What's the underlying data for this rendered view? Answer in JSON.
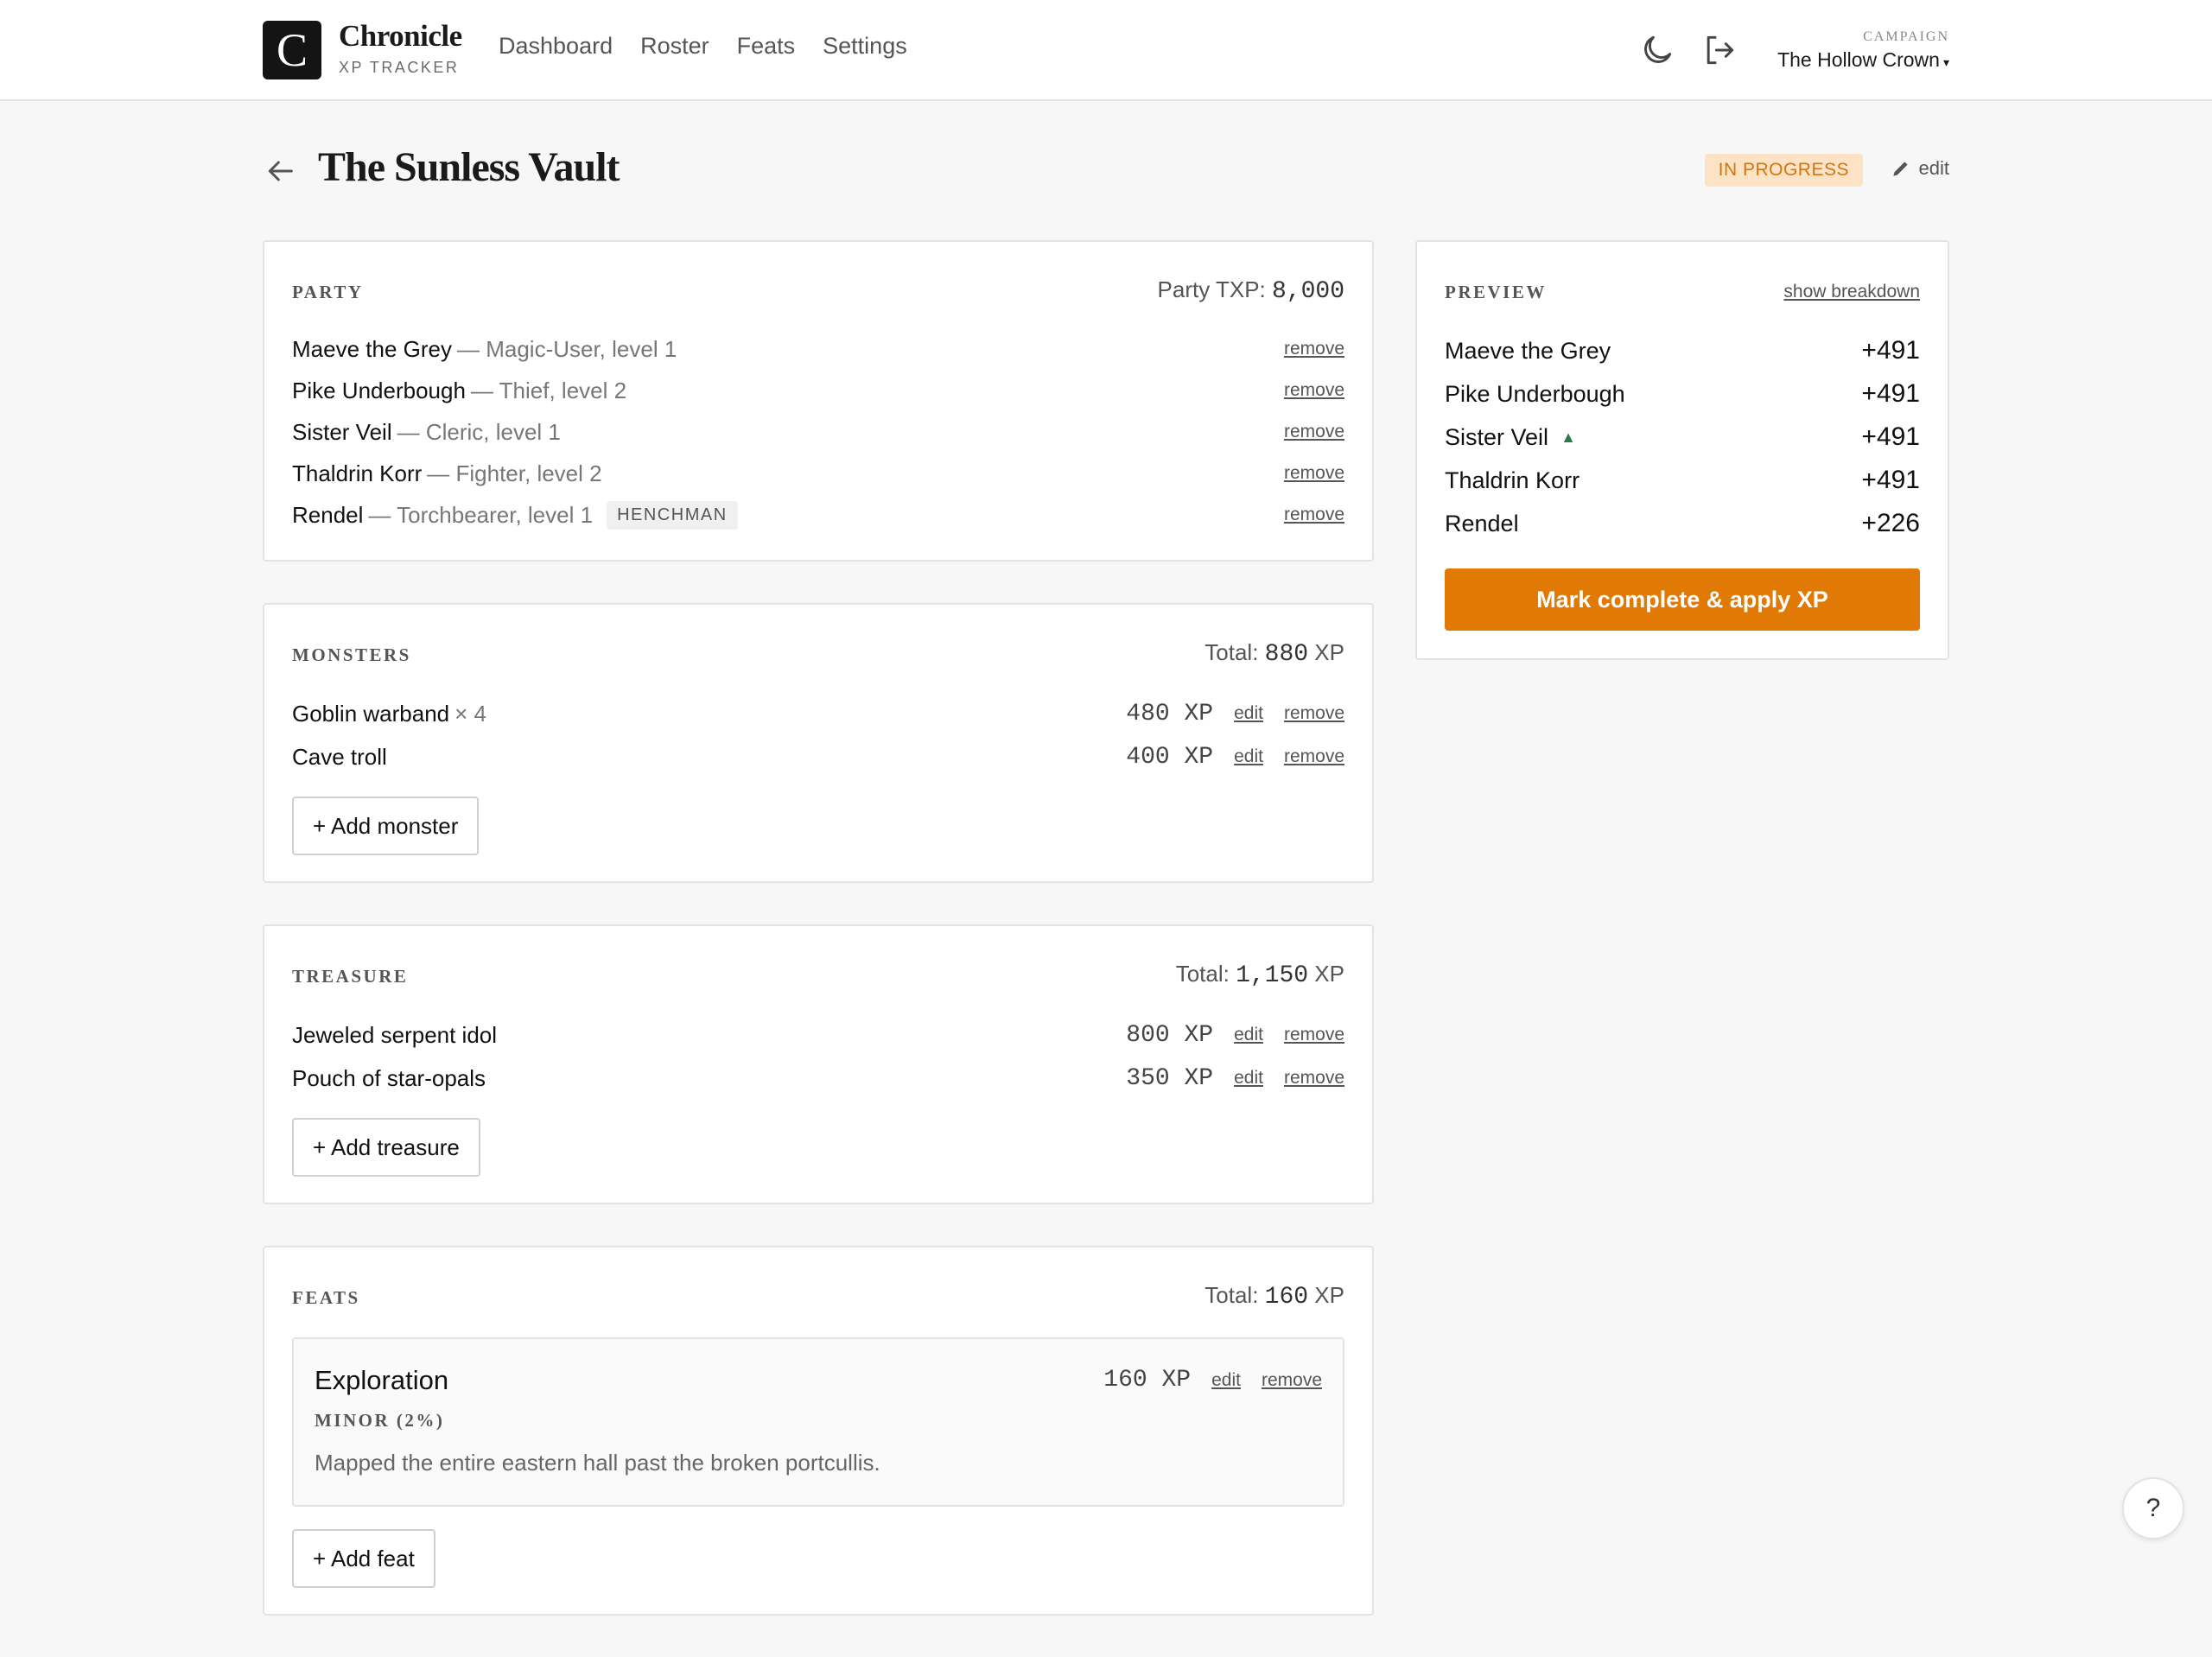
{
  "brand": {
    "logo_letter": "C",
    "name": "Chronicle",
    "subtitle": "XP TRACKER"
  },
  "nav": [
    "Dashboard",
    "Roster",
    "Feats",
    "Settings"
  ],
  "header_icons": [
    "moon-icon",
    "logout-icon"
  ],
  "campaign": {
    "label": "CAMPAIGN",
    "name": "The Hollow Crown",
    "caret": "▾"
  },
  "page": {
    "title": "The Sunless Vault",
    "status": "IN PROGRESS",
    "edit_label": "edit"
  },
  "colors": {
    "accent": "#e07a05",
    "status_bg": "#fde3c6",
    "status_text": "#d4740a",
    "up_arrow": "#2a7a4a"
  },
  "party": {
    "title": "PARTY",
    "total_label": "Party TXP: ",
    "total_value": "8,000",
    "remove_label": "remove",
    "members": [
      {
        "name": "Maeve the Grey",
        "desc": "— Magic-User, level 1"
      },
      {
        "name": "Pike Underbough",
        "desc": "— Thief, level 2"
      },
      {
        "name": "Sister Veil",
        "desc": "— Cleric, level 1"
      },
      {
        "name": "Thaldrin Korr",
        "desc": "— Fighter, level 2"
      },
      {
        "name": "Rendel",
        "desc": "— Torchbearer, level 1",
        "tag": "HENCHMAN"
      }
    ]
  },
  "monsters": {
    "title": "MONSTERS",
    "total_label": "Total: ",
    "total_value": "880",
    "total_unit": " XP",
    "items": [
      {
        "name": "Goblin warband",
        "qty": "× 4",
        "xp": "480 XP"
      },
      {
        "name": "Cave troll",
        "qty": "",
        "xp": "400 XP"
      }
    ],
    "add_label": "+ Add monster"
  },
  "treasure": {
    "title": "TREASURE",
    "total_label": "Total: ",
    "total_value": "1,150",
    "total_unit": " XP",
    "items": [
      {
        "name": "Jeweled serpent idol",
        "xp": "800 XP"
      },
      {
        "name": "Pouch of star-opals",
        "xp": "350 XP"
      }
    ],
    "add_label": "+ Add treasure"
  },
  "feats": {
    "title": "FEATS",
    "total_label": "Total: ",
    "total_value": "160",
    "total_unit": " XP",
    "items": [
      {
        "name": "Exploration",
        "level": "MINOR (2%)",
        "desc": "Mapped the entire eastern hall past the broken portcullis.",
        "xp": "160 XP"
      }
    ],
    "add_label": "+ Add feat"
  },
  "actions": {
    "edit": "edit",
    "remove": "remove"
  },
  "preview": {
    "title": "PREVIEW",
    "breakdown_label": "show breakdown",
    "rows": [
      {
        "name": "Maeve the Grey",
        "value": "+491",
        "level_up": false
      },
      {
        "name": "Pike Underbough",
        "value": "+491",
        "level_up": false
      },
      {
        "name": "Sister Veil",
        "value": "+491",
        "level_up": true,
        "level_up_glyph": "▲"
      },
      {
        "name": "Thaldrin Korr",
        "value": "+491",
        "level_up": false
      },
      {
        "name": "Rendel",
        "value": "+226",
        "level_up": false
      }
    ],
    "apply_label": "Mark complete & apply XP"
  },
  "help_label": "?"
}
